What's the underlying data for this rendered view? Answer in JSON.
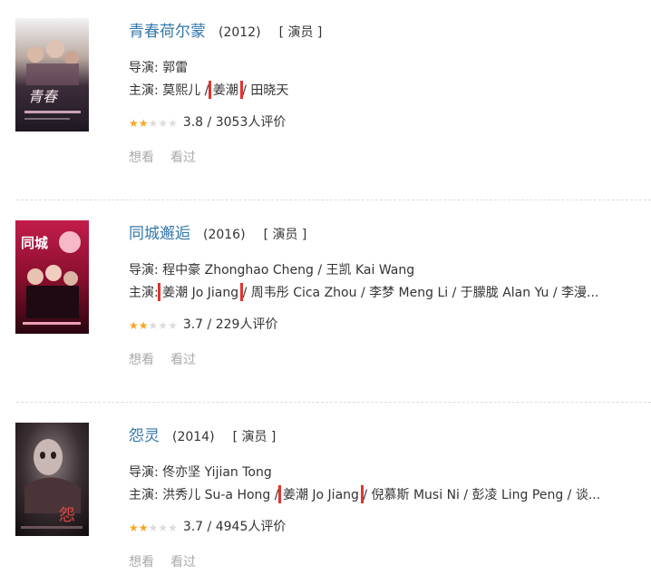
{
  "items": [
    {
      "title": "青春荷尔蒙",
      "year": "(2012)",
      "role": "[ 演员 ]",
      "director_prefix": "导演:",
      "director": "郭雷",
      "cast_prefix": "主演:",
      "cast_before": "莫熙儿",
      "cast_highlight": "姜潮",
      "cast_after": "田晓天",
      "rating": "3.8",
      "rating_count": "3053人评价",
      "stars": 2,
      "want": "想看",
      "watched": "看过"
    },
    {
      "title": "同城邂逅",
      "year": "(2016)",
      "role": "[ 演员 ]",
      "director_prefix": "导演:",
      "director": "程中豪 Zhonghao Cheng / 王凯 Kai Wang",
      "cast_prefix": "主演:",
      "cast_before": "",
      "cast_highlight": "姜潮 Jo Jiang",
      "cast_after": "周韦彤 Cica Zhou / 李梦 Meng Li / 于朦胧 Alan Yu / 李漫...",
      "rating": "3.7",
      "rating_count": "229人评价",
      "stars": 2,
      "want": "想看",
      "watched": "看过"
    },
    {
      "title": "怨灵",
      "year": "(2014)",
      "role": "[ 演员 ]",
      "director_prefix": "导演:",
      "director": "佟亦坚 Yijian Tong",
      "cast_prefix": "主演:",
      "cast_before": "洪秀儿 Su-a Hong",
      "cast_highlight": "姜潮 Jo Jiang",
      "cast_after": "倪慕斯 Musi Ni / 彭凌 Ling Peng / 谈...",
      "rating": "3.7",
      "rating_count": "4945人评价",
      "stars": 2,
      "want": "想看",
      "watched": "看过"
    }
  ],
  "separator": " / ",
  "colors": {
    "title": "#3377aa",
    "highlight": "#e0342f",
    "star": "#f5a623"
  }
}
